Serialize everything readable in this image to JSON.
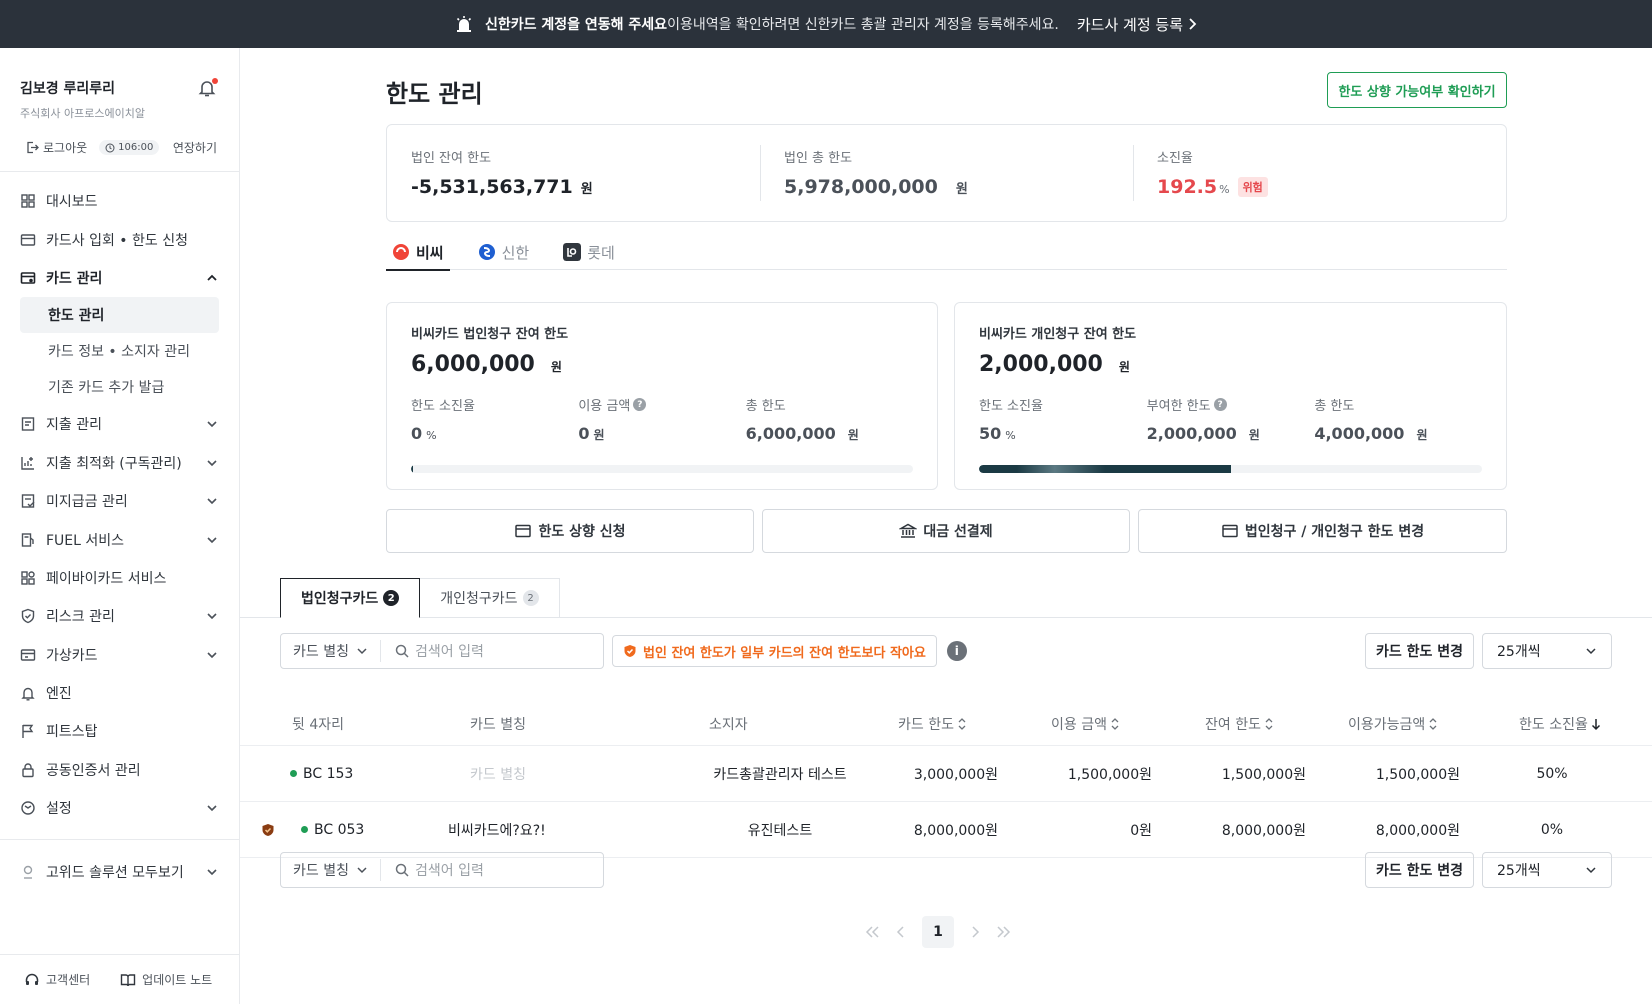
{
  "banner": {
    "bold": "신한카드 계정을 연동해 주세요",
    "text": "이용내역을 확인하려면 신한카드 총괄 관리자 계정을 등록해주세요.",
    "cta": "카드사 계정 등록"
  },
  "user": {
    "name": "김보경 루리루리",
    "company": "주식회사 아프로스에이치알",
    "logout": "로그아웃",
    "timer": "106:00",
    "extend": "연장하기"
  },
  "menu": {
    "dashboard": "대시보드",
    "card_join": "카드사 입회 • 한도 신청",
    "card_manage": "카드 관리",
    "sub_limit": "한도 관리",
    "sub_info": "카드 정보 • 소지자 관리",
    "sub_issue": "기존 카드 추가 발급",
    "expense": "지출 관리",
    "optimize": "지출 최적화 (구독관리)",
    "unpaid": "미지급금 관리",
    "fuel": "FUEL 서비스",
    "paybuy": "페이바이카드 서비스",
    "risk": "리스크 관리",
    "virtual": "가상카드",
    "engine": "엔진",
    "pitstop": "피트스탑",
    "cert": "공동인증서 관리",
    "settings": "설정",
    "all_solutions": "고위드 솔루션 모두보기"
  },
  "footer": {
    "support": "고객센터",
    "update": "업데이트 노트"
  },
  "page": {
    "title": "한도 관리",
    "check_button": "한도 상향 가능여부 확인하기"
  },
  "summary": {
    "remain_label": "법인 잔여 한도",
    "remain_value": "-5,531,563,771",
    "total_label": "법인 총 한도",
    "total_value": "5,978,000,000",
    "rate_label": "소진율",
    "rate_value": "192.5",
    "unit_won": "원",
    "unit_pct": "%",
    "danger": "위험"
  },
  "card_tabs": [
    "비씨",
    "신한",
    "롯데"
  ],
  "corp_card": {
    "title": "비씨카드 법인청구 잔여 한도",
    "amount": "6,000,000",
    "rate_label": "한도 소진율",
    "rate_value": "0",
    "used_label": "이용 금액",
    "used_value": "0",
    "total_label": "총 한도",
    "total_value": "6,000,000",
    "progress": 0.003
  },
  "personal_card": {
    "title": "비씨카드 개인청구 잔여 한도",
    "amount": "2,000,000",
    "rate_label": "한도 소진율",
    "rate_value": "50",
    "given_label": "부여한 한도",
    "given_value": "2,000,000",
    "total_label": "총 한도",
    "total_value": "4,000,000",
    "progress": 0.5
  },
  "actions": {
    "raise": "한도 상향 신청",
    "prepay": "대금 선결제",
    "switch": "법인청구 / 개인청구 한도 변경"
  },
  "list_tabs": {
    "corp": "법인청구카드",
    "corp_count": "2",
    "personal": "개인청구카드",
    "personal_count": "2"
  },
  "toolbar": {
    "filter": "카드 별칭",
    "search_placeholder": "검색어 입력",
    "warning": "법인 잔여 한도가 일부 카드의 잔여 한도보다 작아요",
    "info": "i",
    "limit_change": "카드 한도 변경",
    "page_size": "25개씩"
  },
  "table": {
    "headers": [
      "뒷 4자리",
      "카드 별칭",
      "소지자",
      "카드 한도",
      "이용 금액",
      "잔여 한도",
      "이용가능금액",
      "한도 소진율"
    ],
    "rows": [
      {
        "last4": "BC 153",
        "alias": "카드 별칭",
        "holder": "카드총괄관리자 테스트",
        "limit": "3,000,000원",
        "used": "1,500,000원",
        "remain": "1,500,000원",
        "available": "1,500,000원",
        "rate": "50%"
      },
      {
        "last4": "BC 053",
        "alias": "비씨카드에?요?!",
        "holder": "유진테스트",
        "limit": "8,000,000원",
        "used": "0원",
        "remain": "8,000,000원",
        "available": "8,000,000원",
        "rate": "0%"
      }
    ]
  },
  "pager": {
    "current": "1"
  },
  "colors": {
    "banner_bg": "#2b323b",
    "accent_green": "#1f9d55",
    "danger": "#e5484d",
    "warning": "#f06a1d"
  }
}
